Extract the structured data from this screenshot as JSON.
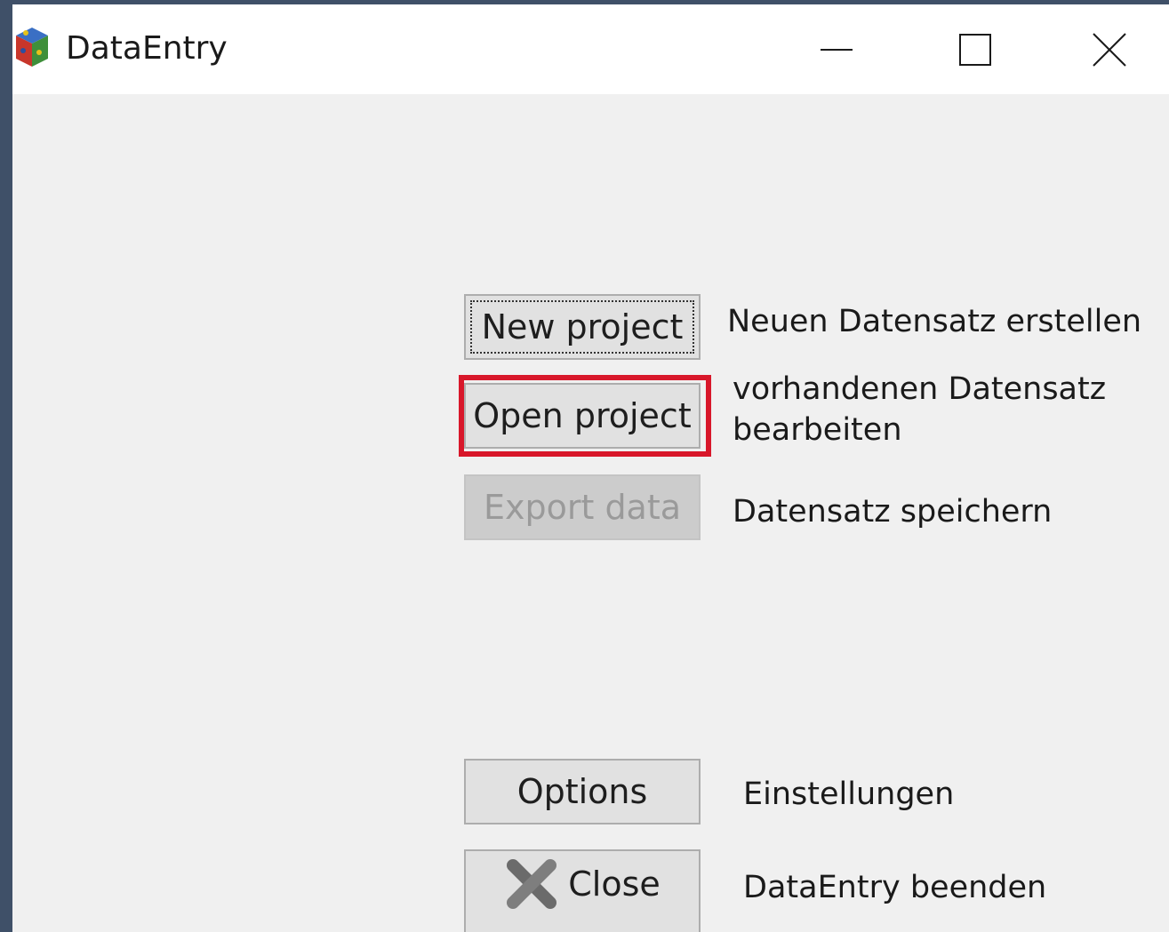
{
  "window": {
    "title": "DataEntry",
    "icon": "app-cube-icon",
    "controls": {
      "minimize": "minimize-icon",
      "maximize": "maximize-icon",
      "close": "close-icon"
    }
  },
  "buttons": {
    "new_project": "New project",
    "open_project": "Open project",
    "export_data": "Export data",
    "options": "Options",
    "close": "Close"
  },
  "descriptions": {
    "new_project": "Neuen Datensatz erstellen",
    "open_project_line1": "vorhandenen Datensatz",
    "open_project_line2": "bearbeiten",
    "export_data": "Datensatz speichern",
    "options": "Einstellungen",
    "close": "DataEntry beenden"
  },
  "state": {
    "export_enabled": false,
    "focused_button": "New project",
    "highlighted_button": "Open project"
  },
  "colors": {
    "highlight": "#d8172a",
    "background": "#f0f0f0",
    "desktop": "#3f5068"
  }
}
